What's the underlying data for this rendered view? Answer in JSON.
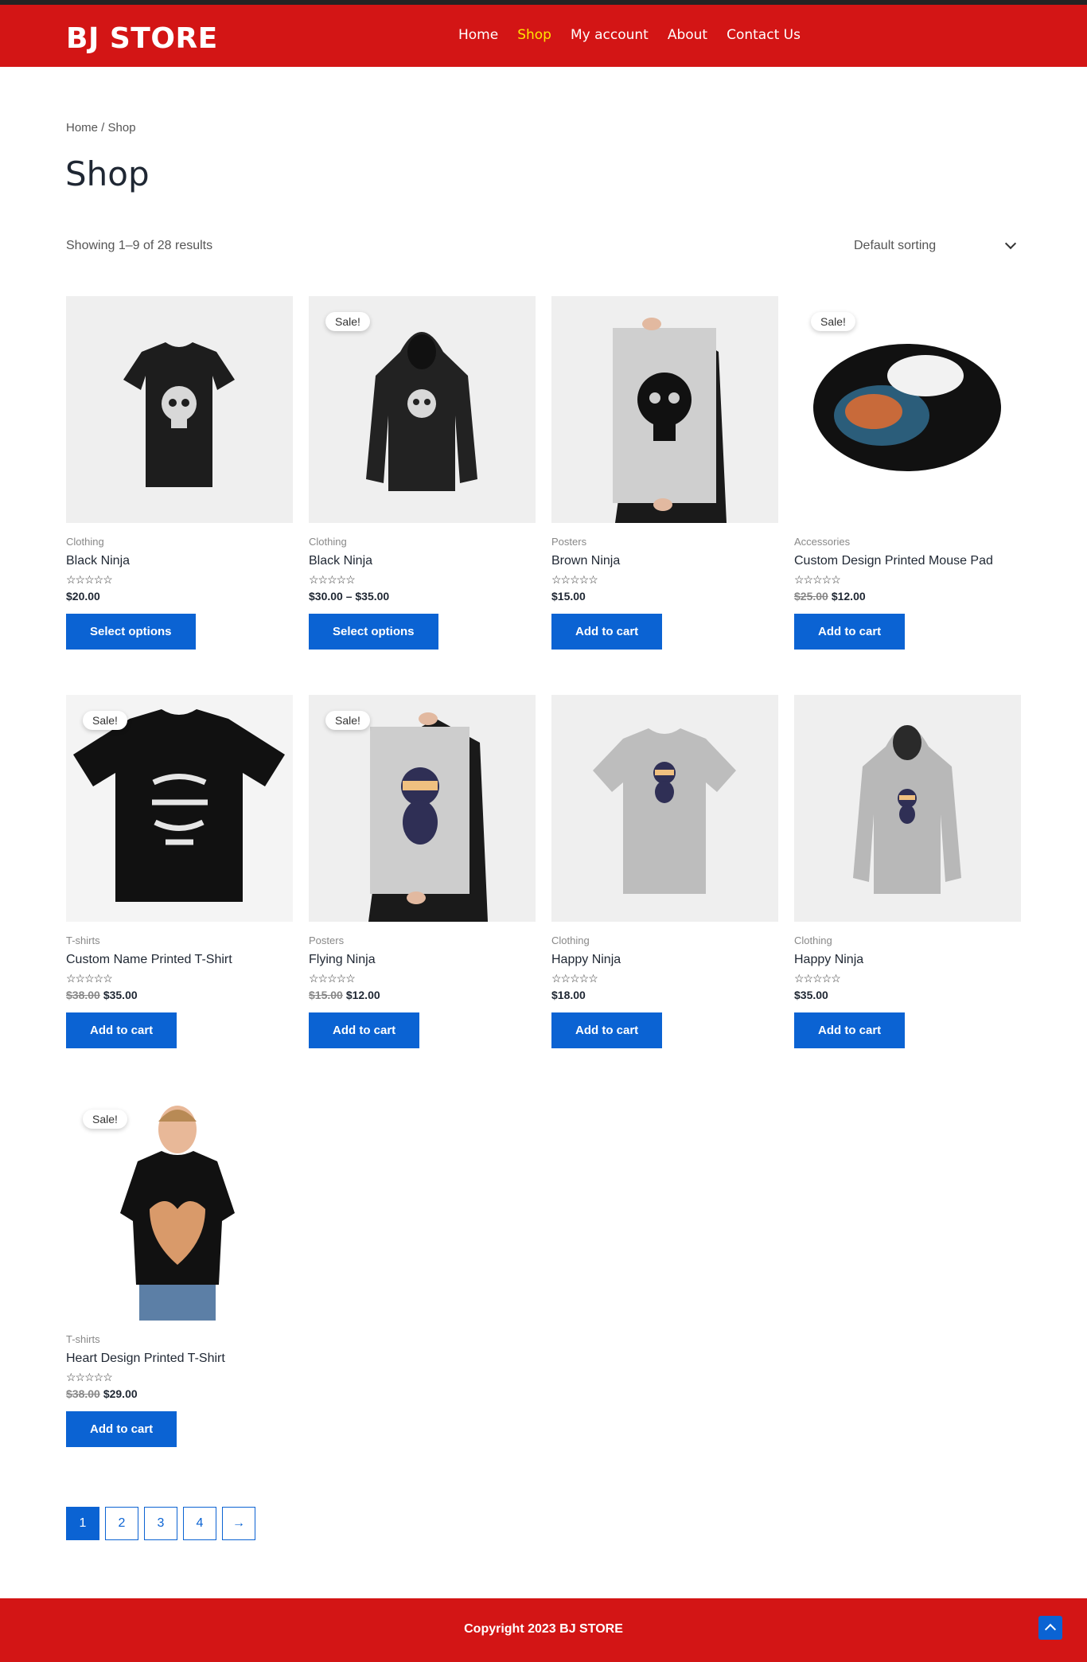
{
  "header": {
    "logo": "BJ STORE",
    "nav": [
      "Home",
      "Shop",
      "My account",
      "About",
      "Contact Us"
    ],
    "active_index": 1
  },
  "breadcrumb": "Home / Shop",
  "page_title": "Shop",
  "result_count": "Showing 1–9 of 28 results",
  "sorting": "Default sorting",
  "products": [
    {
      "category": "Clothing",
      "name": "Black Ninja",
      "stars": "☆☆☆☆☆",
      "old_price": "",
      "price": "$20.00",
      "button": "Select options",
      "sale": "",
      "image": "tshirt-black"
    },
    {
      "category": "Clothing",
      "name": "Black Ninja",
      "stars": "☆☆☆☆☆",
      "old_price": "",
      "price": "$30.00 – $35.00",
      "button": "Select options",
      "sale": "Sale!",
      "image": "hoodie-black"
    },
    {
      "category": "Posters",
      "name": "Brown Ninja",
      "stars": "☆☆☆☆☆",
      "old_price": "",
      "price": "$15.00",
      "button": "Add to cart",
      "sale": "",
      "image": "poster-skull"
    },
    {
      "category": "Accessories",
      "name": "Custom Design Printed Mouse Pad",
      "stars": "☆☆☆☆☆",
      "old_price": "$25.00",
      "price": "$12.00",
      "button": "Add to cart",
      "sale": "Sale!",
      "image": "mousepad"
    },
    {
      "category": "T-shirts",
      "name": "Custom Name Printed T-Shirt",
      "stars": "☆☆☆☆☆",
      "old_price": "$38.00",
      "price": "$35.00",
      "button": "Add to cart",
      "sale": "Sale!",
      "image": "tshirt-black-text"
    },
    {
      "category": "Posters",
      "name": "Flying Ninja",
      "stars": "☆☆☆☆☆",
      "old_price": "$15.00",
      "price": "$12.00",
      "button": "Add to cart",
      "sale": "Sale!",
      "image": "poster-ninja"
    },
    {
      "category": "Clothing",
      "name": "Happy Ninja",
      "stars": "☆☆☆☆☆",
      "old_price": "",
      "price": "$18.00",
      "button": "Add to cart",
      "sale": "",
      "image": "tshirt-grey"
    },
    {
      "category": "Clothing",
      "name": "Happy Ninja",
      "stars": "☆☆☆☆☆",
      "old_price": "",
      "price": "$35.00",
      "button": "Add to cart",
      "sale": "",
      "image": "hoodie-grey"
    },
    {
      "category": "T-shirts",
      "name": "Heart Design Printed T-Shirt",
      "stars": "☆☆☆☆☆",
      "old_price": "$38.00",
      "price": "$29.00",
      "button": "Add to cart",
      "sale": "Sale!",
      "image": "person-tshirt"
    }
  ],
  "pagination": [
    "1",
    "2",
    "3",
    "4",
    "→"
  ],
  "footer": {
    "copyright": "Copyright  2023 BJ STORE"
  },
  "colors": {
    "brand_red": "#d31515",
    "accent_blue": "#0b63d3",
    "active_nav": "#ffe600"
  }
}
